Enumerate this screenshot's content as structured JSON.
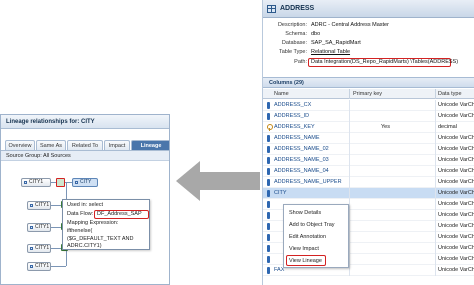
{
  "table_panel": {
    "title": "ADDRESS",
    "properties": [
      {
        "label": "Description:",
        "value": "ADRC - Central Address Master"
      },
      {
        "label": "Schema:",
        "value": "dbo"
      },
      {
        "label": "Database:",
        "value": "SAP_SA_RapidMart"
      },
      {
        "label": "Table Type:",
        "value": "Relational Table"
      },
      {
        "label": "Path:",
        "value": "Data Integration(DS_Repo_RapidMarts) \\Tables(ADDRESS)"
      }
    ],
    "columns_title": "Columns (29)",
    "grid_headers": [
      "Name",
      "Primary key",
      "Data type"
    ],
    "rows": [
      {
        "name": "ADDRESS_CX",
        "pk": "",
        "type": "Unicode VarChar",
        "icon": "column-icon"
      },
      {
        "name": "ADDRESS_ID",
        "pk": "",
        "type": "Unicode VarCh",
        "icon": "column-icon"
      },
      {
        "name": "ADDRESS_KEY",
        "pk": "Yes",
        "type": "decimal",
        "icon": "key-icon"
      },
      {
        "name": "ADDRESS_NAME",
        "pk": "",
        "type": "Unicode VarCh",
        "icon": "column-icon"
      },
      {
        "name": "ADDRESS_NAME_02",
        "pk": "",
        "type": "Unicode VarCh",
        "icon": "column-icon"
      },
      {
        "name": "ADDRESS_NAME_03",
        "pk": "",
        "type": "Unicode VarCh",
        "icon": "column-icon"
      },
      {
        "name": "ADDRESS_NAME_04",
        "pk": "",
        "type": "Unicode VarCh",
        "icon": "column-icon"
      },
      {
        "name": "ADDRESS_NAME_UPPER",
        "pk": "",
        "type": "Unicode VarCh",
        "icon": "column-icon"
      },
      {
        "name": "CITY",
        "pk": "",
        "type": "Unicode VarCh",
        "icon": "column-icon"
      },
      {
        "name": "",
        "pk": "",
        "type": "Unicode VarCh",
        "icon": "column-icon"
      },
      {
        "name": "",
        "pk": "",
        "type": "Unicode VarCh",
        "icon": "column-icon"
      },
      {
        "name": "",
        "pk": "",
        "type": "Unicode VarCh",
        "icon": "column-icon"
      },
      {
        "name": "",
        "pk": "",
        "type": "Unicode VarCh",
        "icon": "column-icon"
      },
      {
        "name": "",
        "pk": "",
        "type": "Unicode VarCh",
        "icon": "column-icon"
      },
      {
        "name": "",
        "pk": "",
        "type": "Unicode VarCh",
        "icon": "column-icon"
      },
      {
        "name": "FAX",
        "pk": "",
        "type": "Unicode VarCh",
        "icon": "column-icon"
      }
    ],
    "context_menu": [
      "Show Details",
      "Add to Object Tray",
      "Edit Annotation",
      "View Impact",
      "View Lineage"
    ]
  },
  "lineage_panel": {
    "title": "Lineage relationships for: CITY",
    "tabs": [
      "Overview",
      "Same As",
      "Related To",
      "Impact",
      "Lineage"
    ],
    "active_tab": "Lineage",
    "source_group": "Source Group: All Sources",
    "source_nodes": [
      "CITY1",
      "CITY1",
      "CITY1",
      "CITY1",
      "CITY1"
    ],
    "target_node": "CITY",
    "tooltip": {
      "used_in": "Used in: select",
      "data_flow_label": "Data Flow:",
      "data_flow_value": "DF_Address_SAP",
      "mapping_label": "Mapping Expression:",
      "mapping_line1": "ifthenelse(",
      "mapping_line2": "($G_DEFAULT_TEXT AND",
      "mapping_line3": "ADRC.CITY1)"
    }
  },
  "colors": {
    "highlight": "#d32222",
    "selected_row": "#c8dcf3",
    "header_blue": "#4a76ab",
    "arrow_gray": "#a8a8a8"
  }
}
